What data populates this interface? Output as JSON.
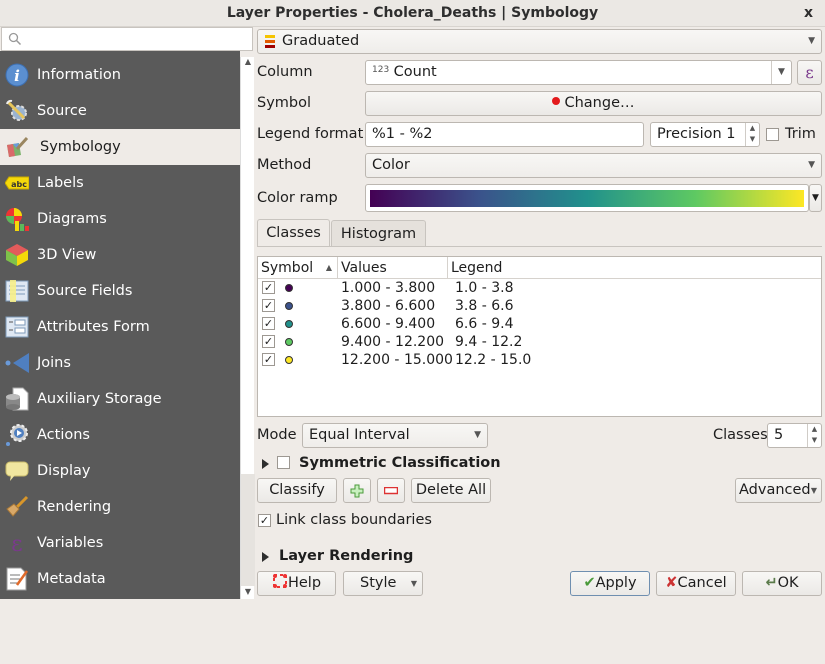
{
  "window": {
    "title": "Layer Properties - Cholera_Deaths | Symbology",
    "close_label": "x"
  },
  "sidebar": {
    "search_placeholder": "",
    "items": [
      {
        "label": "Information",
        "icon": "info-icon"
      },
      {
        "label": "Source",
        "icon": "source-settings-icon"
      },
      {
        "label": "Symbology",
        "icon": "symbology-brush-icon",
        "active": true
      },
      {
        "label": "Labels",
        "icon": "labels-abc-icon"
      },
      {
        "label": "Diagrams",
        "icon": "diagrams-icon"
      },
      {
        "label": "3D View",
        "icon": "3d-cube-icon"
      },
      {
        "label": "Source Fields",
        "icon": "source-fields-icon"
      },
      {
        "label": "Attributes Form",
        "icon": "attributes-form-icon"
      },
      {
        "label": "Joins",
        "icon": "joins-icon"
      },
      {
        "label": "Auxiliary Storage",
        "icon": "auxiliary-storage-icon"
      },
      {
        "label": "Actions",
        "icon": "actions-gear-icon"
      },
      {
        "label": "Display",
        "icon": "display-speech-bubble-icon"
      },
      {
        "label": "Rendering",
        "icon": "rendering-brush-icon"
      },
      {
        "label": "Variables",
        "icon": "variables-epsilon-icon"
      },
      {
        "label": "Metadata",
        "icon": "metadata-document-icon"
      }
    ]
  },
  "renderer": {
    "type": "Graduated"
  },
  "form": {
    "column_label": "Column",
    "column_type_badge": "123",
    "column_value": "Count",
    "expression_glyph": "ε",
    "symbol_label": "Symbol",
    "symbol_button": "Change…",
    "symbol_color": "#e31a1c",
    "legend_format_label": "Legend format",
    "legend_format_value": "%1 - %2",
    "precision_value": "Precision 1",
    "trim_label": "Trim",
    "trim_checked": false,
    "method_label": "Method",
    "method_value": "Color",
    "color_ramp_label": "Color ramp",
    "color_ramp_stops": [
      "#440154",
      "#3b528b",
      "#21918c",
      "#5ec962",
      "#fde725"
    ]
  },
  "tabs": [
    {
      "label": "Classes",
      "active": true
    },
    {
      "label": "Histogram",
      "active": false
    }
  ],
  "classes_table": {
    "headers": [
      "Symbol",
      "Values",
      "Legend"
    ],
    "sort_indicator": "▲",
    "rows": [
      {
        "checked": true,
        "color": "#440154",
        "values": "1.000 - 3.800",
        "legend": "1.0 - 3.8"
      },
      {
        "checked": true,
        "color": "#3b528b",
        "values": "3.800 - 6.600",
        "legend": "3.8 - 6.6"
      },
      {
        "checked": true,
        "color": "#21918c",
        "values": "6.600 - 9.400",
        "legend": "6.6 - 9.4"
      },
      {
        "checked": true,
        "color": "#5ec962",
        "values": "9.400 - 12.200",
        "legend": "9.4 - 12.2"
      },
      {
        "checked": true,
        "color": "#fde725",
        "values": "12.200 - 15.000",
        "legend": "12.2 - 15.0"
      }
    ]
  },
  "controls": {
    "mode_label": "Mode",
    "mode_value": "Equal Interval",
    "classes_label": "Classes",
    "classes_value": "5",
    "symmetric_label": "Symmetric Classification",
    "symmetric_checked": false,
    "classify_button": "Classify",
    "delete_all_button": "Delete All",
    "advanced_button": "Advanced",
    "link_boundaries_label": "Link class boundaries",
    "link_boundaries_checked": true,
    "layer_rendering_label": "Layer Rendering"
  },
  "footer": {
    "help_button": "Help",
    "style_button": "Style",
    "apply_button": "Apply",
    "cancel_button": "Cancel",
    "ok_button": "OK"
  }
}
